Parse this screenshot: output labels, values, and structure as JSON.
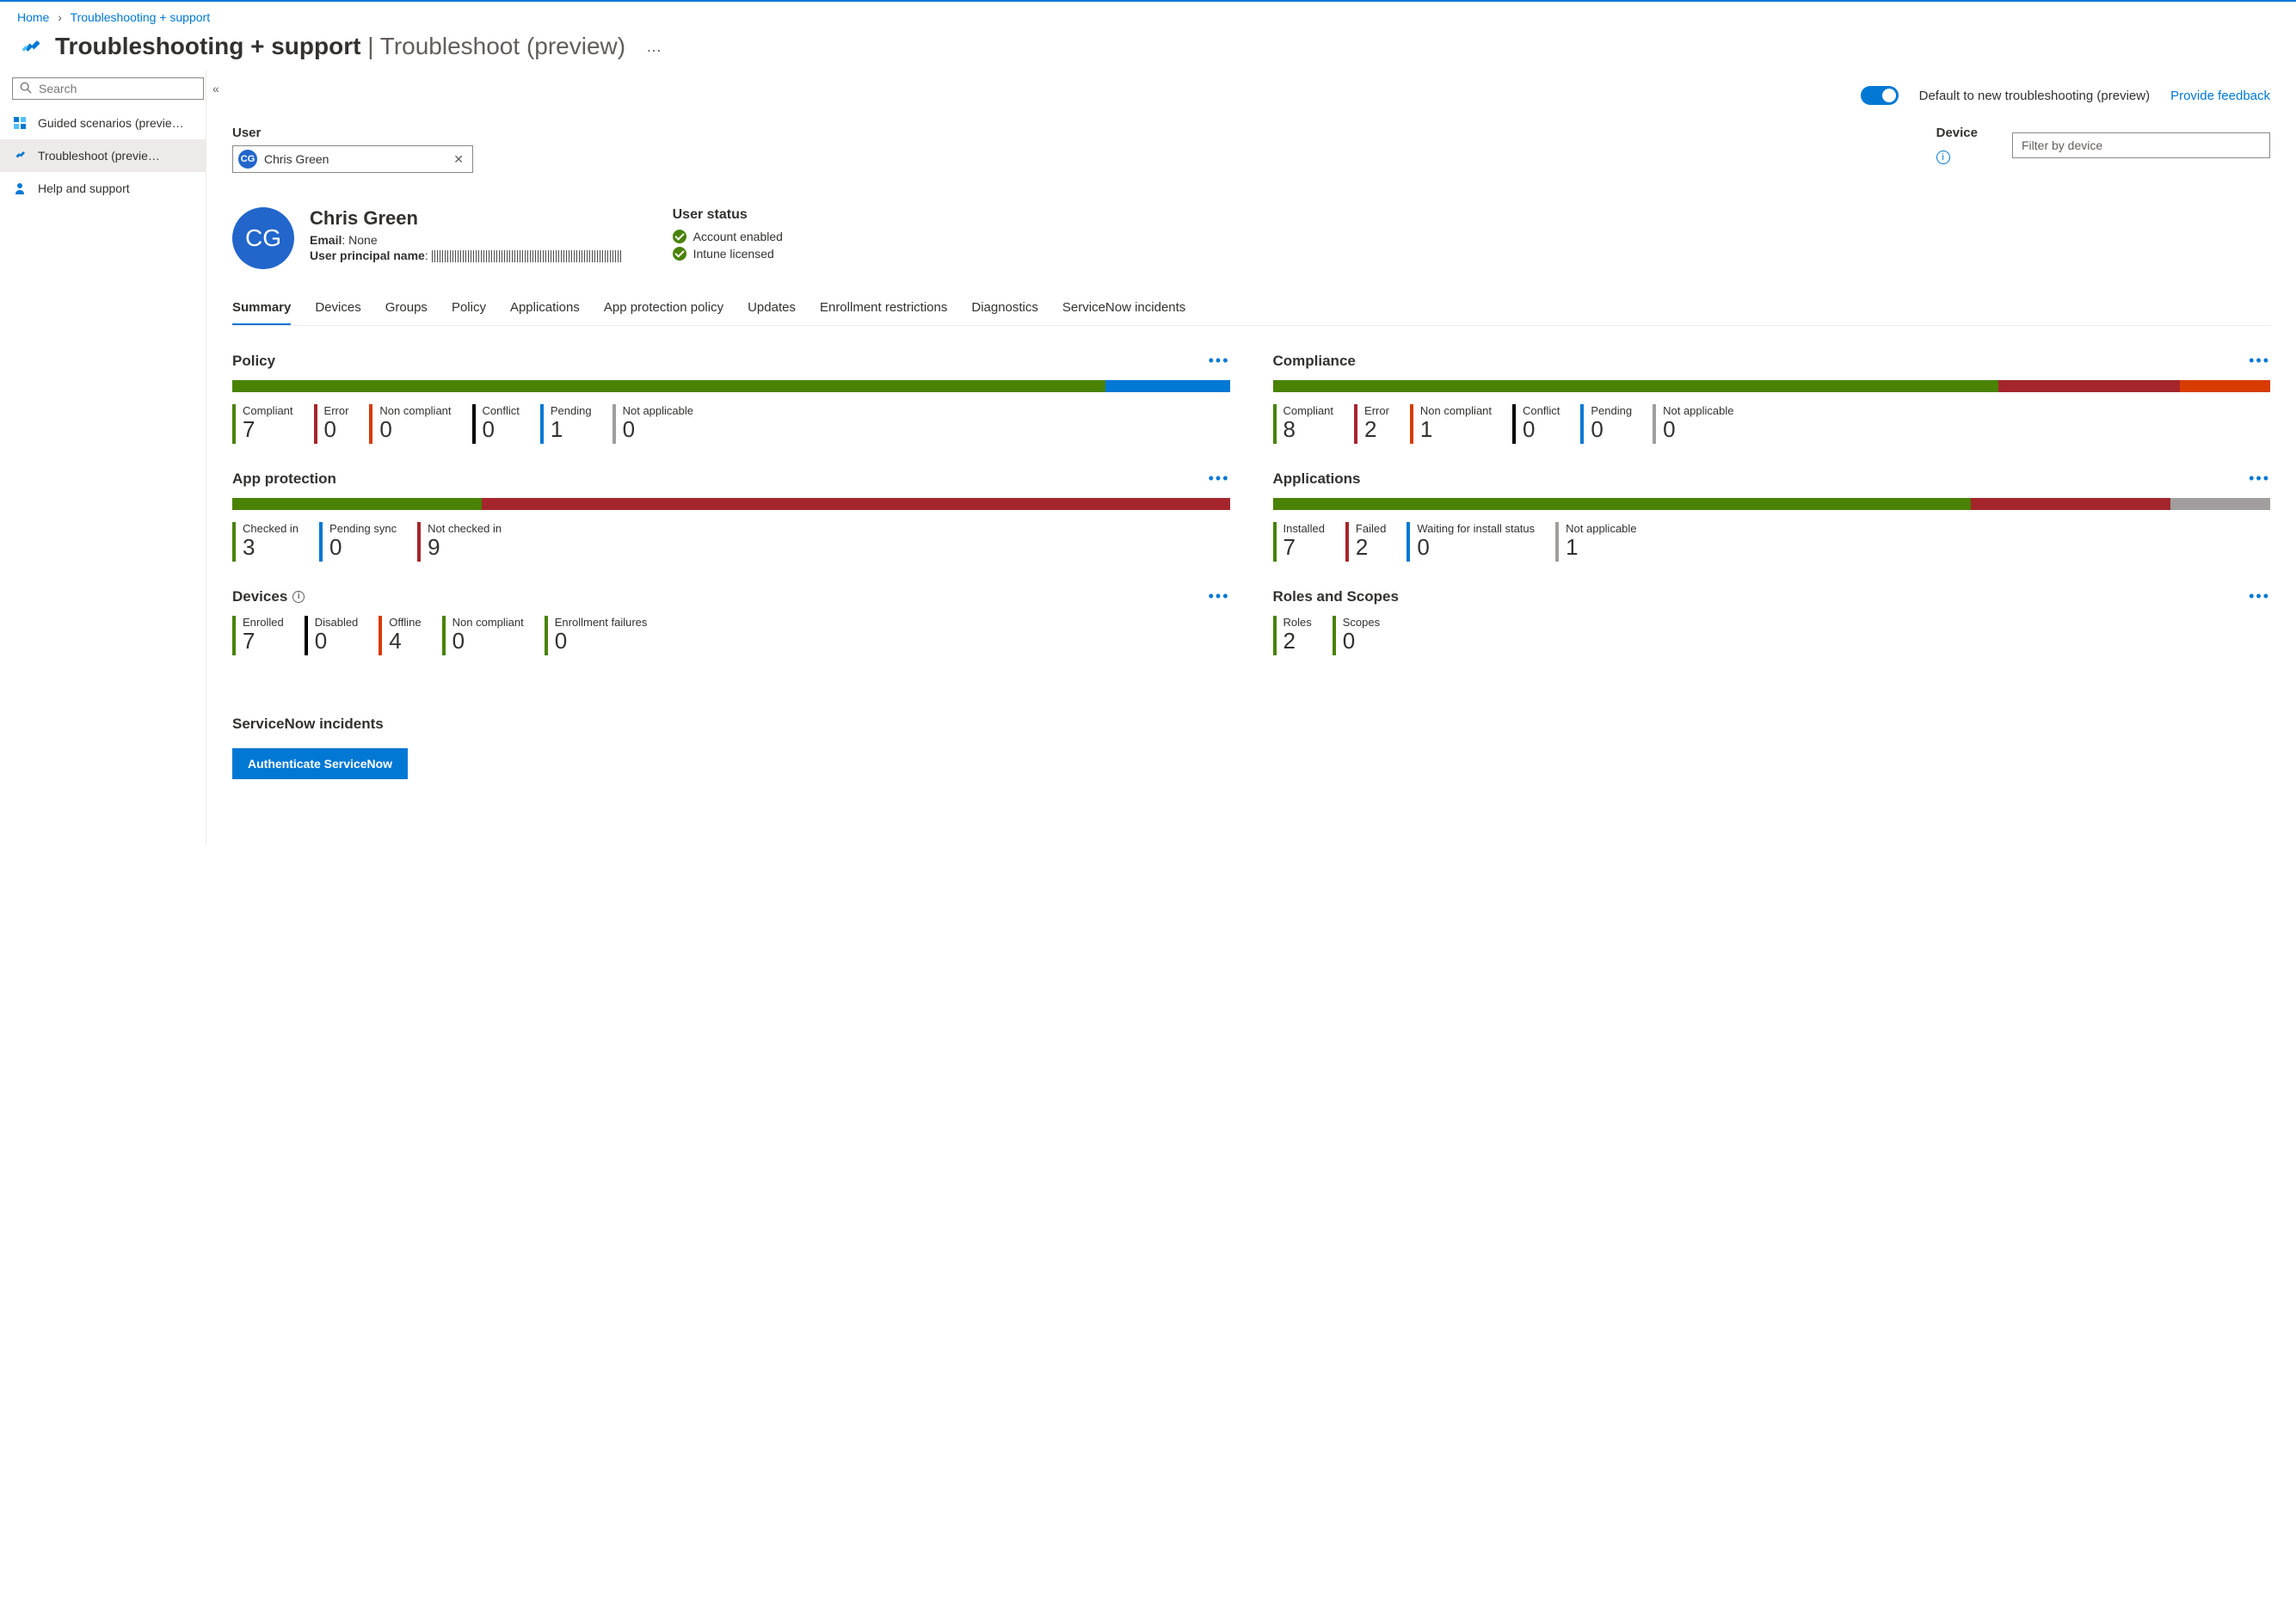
{
  "breadcrumb": {
    "home": "Home",
    "section": "Troubleshooting + support"
  },
  "page_title": {
    "main": "Troubleshooting + support",
    "sub": "Troubleshoot (preview)"
  },
  "sidebar": {
    "search_placeholder": "Search",
    "items": [
      {
        "label": "Guided scenarios (previe…"
      },
      {
        "label": "Troubleshoot (previe…"
      },
      {
        "label": "Help and support"
      }
    ]
  },
  "toolbar": {
    "toggle_label": "Default to new troubleshooting (preview)",
    "feedback": "Provide feedback"
  },
  "filters": {
    "user_label": "User",
    "user_chip": "Chris Green",
    "user_initials": "CG",
    "device_label": "Device",
    "device_placeholder": "Filter by device"
  },
  "user": {
    "name": "Chris Green",
    "initials": "CG",
    "email_label": "Email",
    "email_value": "None",
    "upn_label": "User principal name",
    "status_title": "User status",
    "statuses": [
      "Account enabled",
      "Intune licensed"
    ]
  },
  "tabs": [
    "Summary",
    "Devices",
    "Groups",
    "Policy",
    "Applications",
    "App protection policy",
    "Updates",
    "Enrollment restrictions",
    "Diagnostics",
    "ServiceNow incidents"
  ],
  "cards": {
    "policy": {
      "title": "Policy",
      "bar": [
        {
          "color": "c-green",
          "flex": 7
        },
        {
          "color": "c-blue",
          "flex": 1
        }
      ],
      "metrics": [
        {
          "label": "Compliant",
          "value": "7",
          "color": "c-green"
        },
        {
          "label": "Error",
          "value": "0",
          "color": "c-red"
        },
        {
          "label": "Non compliant",
          "value": "0",
          "color": "c-orange"
        },
        {
          "label": "Conflict",
          "value": "0",
          "color": "c-black"
        },
        {
          "label": "Pending",
          "value": "1",
          "color": "c-blue"
        },
        {
          "label": "Not applicable",
          "value": "0",
          "color": "c-gray"
        }
      ]
    },
    "compliance": {
      "title": "Compliance",
      "bar": [
        {
          "color": "c-green",
          "flex": 8
        },
        {
          "color": "c-red",
          "flex": 2
        },
        {
          "color": "c-orange",
          "flex": 1
        }
      ],
      "metrics": [
        {
          "label": "Compliant",
          "value": "8",
          "color": "c-green"
        },
        {
          "label": "Error",
          "value": "2",
          "color": "c-red"
        },
        {
          "label": "Non compliant",
          "value": "1",
          "color": "c-orange"
        },
        {
          "label": "Conflict",
          "value": "0",
          "color": "c-black"
        },
        {
          "label": "Pending",
          "value": "0",
          "color": "c-blue"
        },
        {
          "label": "Not applicable",
          "value": "0",
          "color": "c-gray"
        }
      ]
    },
    "app_protection": {
      "title": "App protection",
      "bar": [
        {
          "color": "c-green",
          "flex": 3
        },
        {
          "color": "c-red",
          "flex": 9
        }
      ],
      "metrics": [
        {
          "label": "Checked in",
          "value": "3",
          "color": "c-green"
        },
        {
          "label": "Pending sync",
          "value": "0",
          "color": "c-blue"
        },
        {
          "label": "Not checked in",
          "value": "9",
          "color": "c-red"
        }
      ]
    },
    "applications": {
      "title": "Applications",
      "bar": [
        {
          "color": "c-green",
          "flex": 7
        },
        {
          "color": "c-red",
          "flex": 2
        },
        {
          "color": "c-gray",
          "flex": 1
        }
      ],
      "metrics": [
        {
          "label": "Installed",
          "value": "7",
          "color": "c-green"
        },
        {
          "label": "Failed",
          "value": "2",
          "color": "c-red"
        },
        {
          "label": "Waiting for install status",
          "value": "0",
          "color": "c-blue"
        },
        {
          "label": "Not applicable",
          "value": "1",
          "color": "c-gray"
        }
      ]
    },
    "devices": {
      "title": "Devices",
      "info": true,
      "metrics": [
        {
          "label": "Enrolled",
          "value": "7",
          "color": "c-green"
        },
        {
          "label": "Disabled",
          "value": "0",
          "color": "c-black"
        },
        {
          "label": "Offline",
          "value": "4",
          "color": "c-orange"
        },
        {
          "label": "Non compliant",
          "value": "0",
          "color": "c-green"
        },
        {
          "label": "Enrollment failures",
          "value": "0",
          "color": "c-green"
        }
      ]
    },
    "roles": {
      "title": "Roles and Scopes",
      "metrics": [
        {
          "label": "Roles",
          "value": "2",
          "color": "c-green"
        },
        {
          "label": "Scopes",
          "value": "0",
          "color": "c-green"
        }
      ]
    }
  },
  "servicenow": {
    "title": "ServiceNow incidents",
    "button": "Authenticate ServiceNow"
  }
}
